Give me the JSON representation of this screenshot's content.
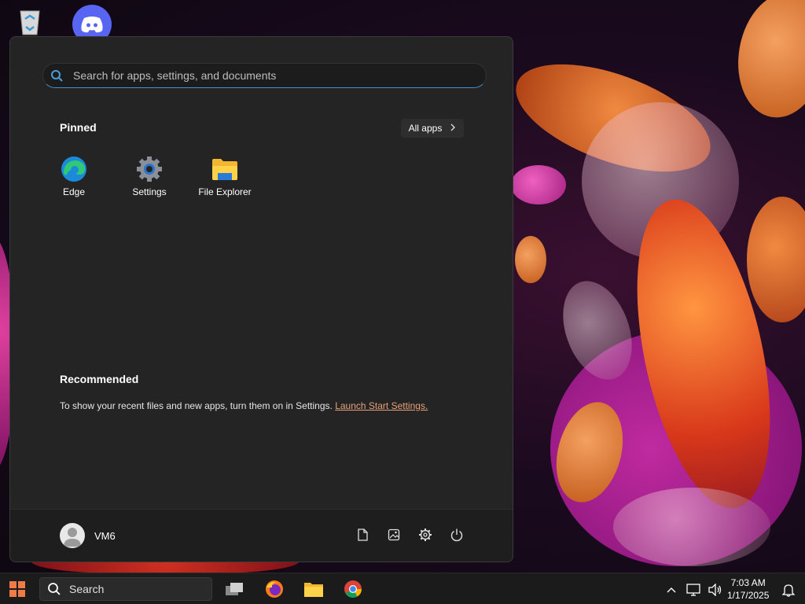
{
  "start_menu": {
    "search_placeholder": "Search for apps, settings, and documents",
    "pinned_title": "Pinned",
    "all_apps_label": "All apps",
    "pinned_apps": [
      {
        "label": "Edge",
        "icon": "edge-icon"
      },
      {
        "label": "Settings",
        "icon": "gear-icon"
      },
      {
        "label": "File Explorer",
        "icon": "folder-icon"
      }
    ],
    "recommended_title": "Recommended",
    "recommended_text": "To show your recent files and new apps, turn them on in Settings.",
    "recommended_link": "Launch Start Settings.",
    "user_name": "VM6"
  },
  "taskbar": {
    "search_label": "Search",
    "time": "7:03 AM",
    "date": "1/17/2025"
  },
  "colors": {
    "accent": "#f07a48",
    "link": "#e8a07a"
  }
}
